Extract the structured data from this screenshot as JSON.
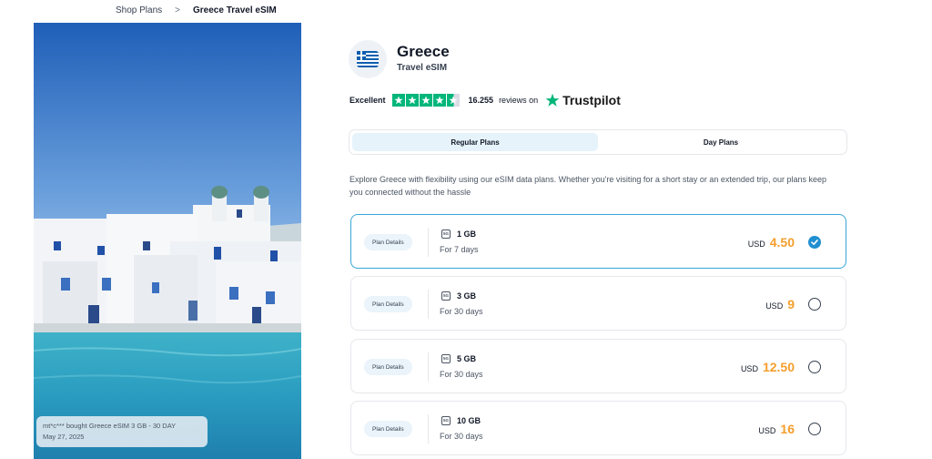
{
  "breadcrumb": {
    "parent": "Shop Plans",
    "separator": ">",
    "current": "Greece Travel eSIM"
  },
  "toast": {
    "line1": "mt*c*** bought Greece eSIM 3 GB - 30 DAY",
    "line2": "May 27, 2025"
  },
  "header": {
    "title": "Greece",
    "subtitle": "Travel eSIM",
    "flag_icon": "greece-flag-icon"
  },
  "rating": {
    "label": "Excellent",
    "stars": 4.5,
    "count": "16.255",
    "reviews_text": "reviews on",
    "brand": "Trustpilot",
    "brand_color": "#00b67a"
  },
  "tabs": [
    {
      "label": "Regular Plans",
      "active": true
    },
    {
      "label": "Day Plans",
      "active": false
    }
  ],
  "description": "Explore Greece with flexibility using our eSIM data plans. Whether you're visiting for a short stay or an extended trip, our plans keep you connected without the hassle",
  "plans": [
    {
      "details_label": "Plan Details",
      "network": "5G",
      "data": "1 GB",
      "duration": "For 7 days",
      "currency": "USD",
      "price": "4.50",
      "selected": true
    },
    {
      "details_label": "Plan Details",
      "network": "5G",
      "data": "3 GB",
      "duration": "For 30 days",
      "currency": "USD",
      "price": "9",
      "selected": false
    },
    {
      "details_label": "Plan Details",
      "network": "5G",
      "data": "5 GB",
      "duration": "For 30 days",
      "currency": "USD",
      "price": "12.50",
      "selected": false
    },
    {
      "details_label": "Plan Details",
      "network": "5G",
      "data": "10 GB",
      "duration": "For 30 days",
      "currency": "USD",
      "price": "16",
      "selected": false
    }
  ],
  "colors": {
    "accent": "#1f8fd1",
    "price": "#f59e2c",
    "selected_border": "#38a6d6"
  }
}
